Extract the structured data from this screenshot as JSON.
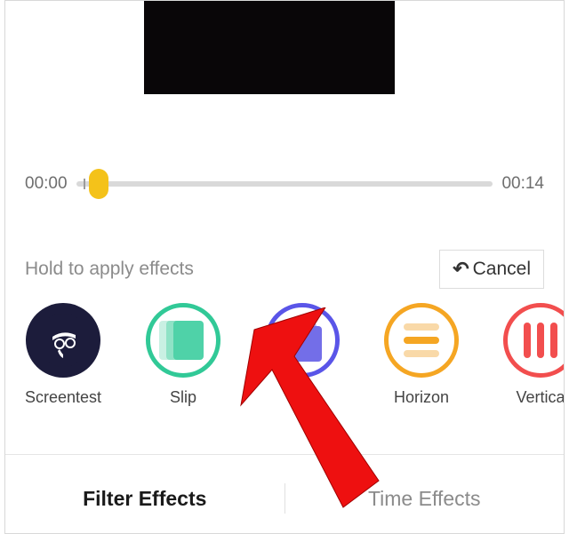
{
  "timeline": {
    "start": "00:00",
    "end": "00:14"
  },
  "instruction": "Hold to apply effects",
  "cancel": {
    "label": "Cancel"
  },
  "effects": [
    {
      "label": "Screentest"
    },
    {
      "label": "Slip"
    },
    {
      "label": ""
    },
    {
      "label": "Horizon"
    },
    {
      "label": "Vertica"
    }
  ],
  "tabs": {
    "filter": "Filter Effects",
    "time": "Time Effects"
  }
}
